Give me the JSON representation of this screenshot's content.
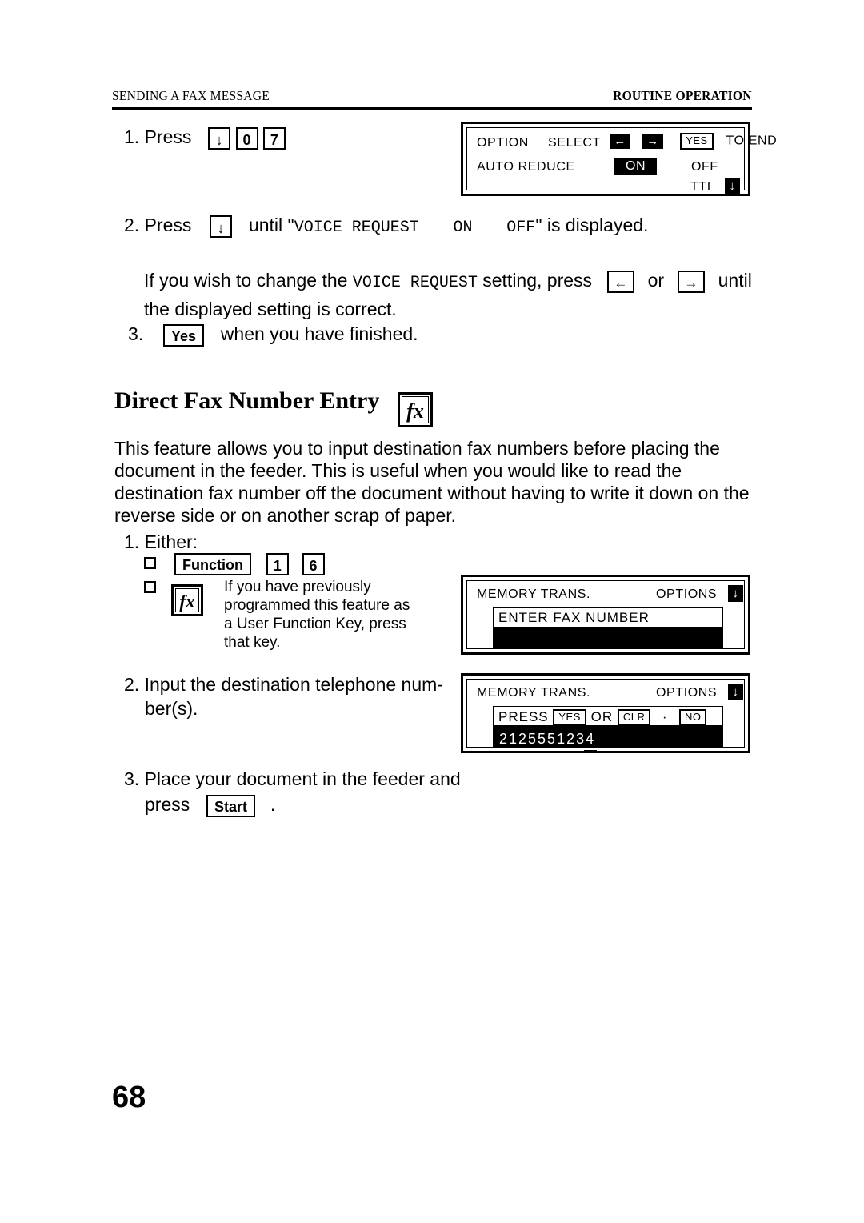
{
  "header": {
    "left": "SENDING A FAX MESSAGE",
    "right": "ROUTINE OPERATION"
  },
  "steps_top": {
    "s1": {
      "num": "1.",
      "label": "Press",
      "keys": [
        "↓",
        "0",
        "7"
      ]
    },
    "s2": {
      "num": "2.",
      "label_before": "Press",
      "key": "↓",
      "label_mid": "until \"",
      "display_text": "VOICE REQUEST",
      "display_on": "ON",
      "display_off": "OFF",
      "label_after": "\" is displayed."
    },
    "note": {
      "line1_a": "If you wish to change the",
      "line1_mono": "VOICE REQUEST",
      "line1_b": "setting, press",
      "key_left": "←",
      "or": "or",
      "key_right": "→",
      "line1_c": "until",
      "line2": "the displayed setting is correct."
    },
    "s3": {
      "num": "3.",
      "key": "Yes",
      "text": "when you have finished."
    }
  },
  "section": {
    "heading": "Direct Fax Number Entry",
    "heading_icon": "fx",
    "paragraph": "This feature allows you to input destination fax numbers before placing the document in the feeder. This is useful when you would like to read the destination fax number off the document without having to write it down on the reverse side or on another scrap of paper."
  },
  "steps_bottom": {
    "s1": {
      "num": "1.",
      "label": "Either:",
      "option_a_keys": [
        "Function",
        "1",
        "6"
      ],
      "option_b_icon": "fx",
      "option_b_text": "If you have previously programmed this feature as a User Function Key, press that key."
    },
    "s2": {
      "num": "2.",
      "text": "Input the destination telephone num-",
      "text_line2": "ber(s)."
    },
    "s3": {
      "num": "3.",
      "text": "Place your document in the feeder and",
      "text_line2_before": "press",
      "key": "Start",
      "text_line2_after": "."
    }
  },
  "lcd1": {
    "title": "OPTION",
    "title2": "SELECT",
    "arrow_left": "←",
    "arrow_right": "→",
    "yes_key": "YES",
    "to_end": "TO END",
    "setting_label": "AUTO REDUCE",
    "setting_on": "ON",
    "setting_off": "OFF",
    "next_label": "TTI",
    "down_arrow": "↓"
  },
  "lcd2": {
    "title": "MEMORY TRANS.",
    "options": "OPTIONS",
    "down_arrow": "↓",
    "field_text": "ENTER FAX NUMBER",
    "entry_value": ""
  },
  "lcd3": {
    "title": "MEMORY TRANS.",
    "options": "OPTIONS",
    "down_arrow": "↓",
    "prompt_press": "PRESS",
    "prompt_yes": "YES",
    "prompt_or": "OR",
    "prompt_clr": "CLR",
    "prompt_dot": "·",
    "prompt_no": "NO",
    "entry_value": "2125551234"
  },
  "footer": {
    "page_number": "68"
  }
}
